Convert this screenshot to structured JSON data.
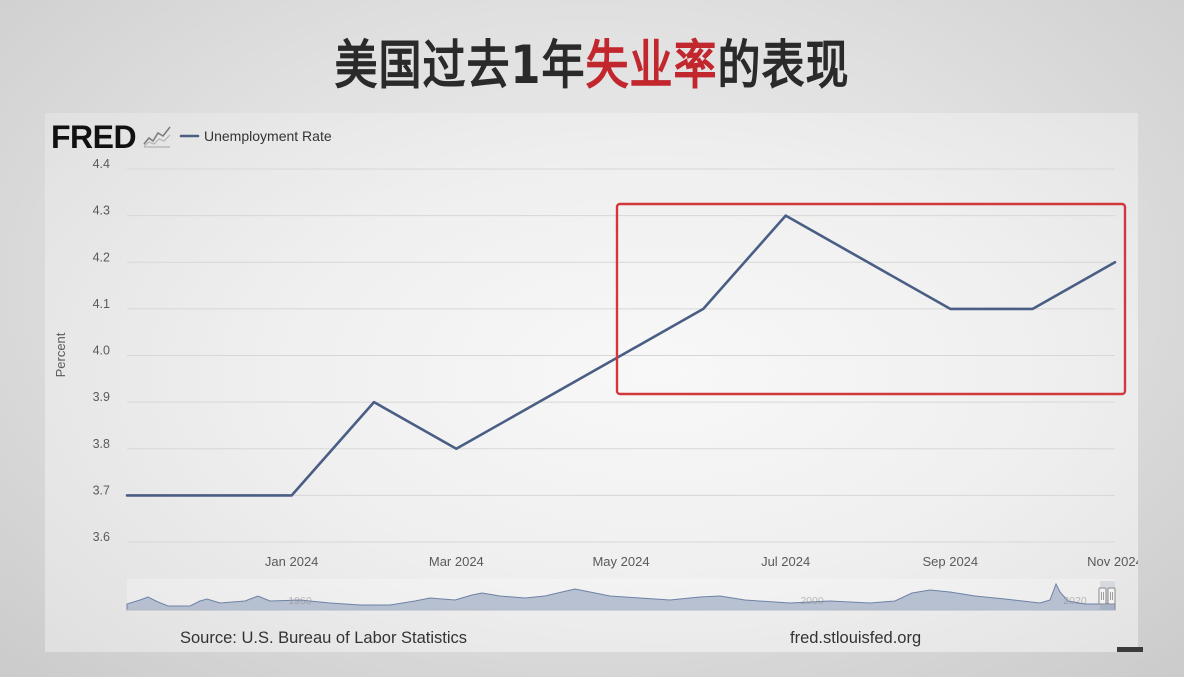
{
  "header": {
    "title_prefix": "美国过去1年",
    "title_highlight": "失业率",
    "title_suffix": "的表现"
  },
  "colors": {
    "title_text": "#2a2a2a",
    "title_highlight": "#c1272d",
    "series_line": "#4a5e85",
    "highlight_box": "#d2383b",
    "grid": "#d7d7d7",
    "axis_text": "#5a5a5a",
    "navigator_fill": "#a3b0c6",
    "navigator_stroke": "#6e82a6"
  },
  "fred": {
    "logo_text": "FRED",
    "logo_icon": "fred-graph-icon",
    "source": "Source: U.S. Bureau of Labor Statistics",
    "website": "fred.stlouisfed.org"
  },
  "navigator": {
    "year_labels": [
      "1960",
      "2000",
      "2020"
    ]
  },
  "chart_data": {
    "type": "line",
    "ylabel": "Percent",
    "x": [
      "2023-11",
      "2023-12",
      "2024-01",
      "2024-02",
      "2024-03",
      "2024-04",
      "2024-05",
      "2024-06",
      "2024-07",
      "2024-08",
      "2024-09",
      "2024-10",
      "2024-11"
    ],
    "xlim": [
      "2023-11",
      "2024-11"
    ],
    "x_ticks": [
      {
        "at": "2024-01",
        "label": "Jan 2024"
      },
      {
        "at": "2024-03",
        "label": "Mar 2024"
      },
      {
        "at": "2024-05",
        "label": "May 2024"
      },
      {
        "at": "2024-07",
        "label": "Jul 2024"
      },
      {
        "at": "2024-09",
        "label": "Sep 2024"
      },
      {
        "at": "2024-11",
        "label": "Nov 2024"
      }
    ],
    "y_ticks": [
      3.6,
      3.7,
      3.8,
      3.9,
      4.0,
      4.1,
      4.2,
      4.3,
      4.4
    ],
    "ylim": [
      3.6,
      4.4
    ],
    "grid": true,
    "legend": "top-left",
    "series": [
      {
        "name": "Unemployment Rate",
        "values": [
          3.7,
          3.7,
          3.7,
          3.9,
          3.8,
          3.9,
          4.0,
          4.1,
          4.3,
          4.2,
          4.1,
          4.1,
          4.2
        ]
      }
    ]
  }
}
